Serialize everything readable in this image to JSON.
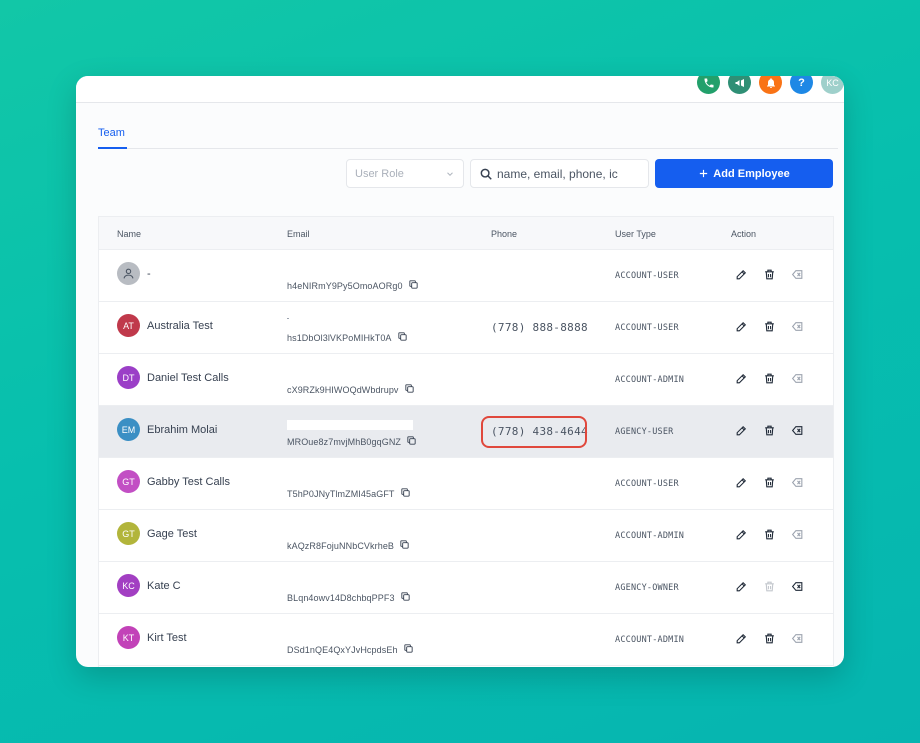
{
  "topbar": {
    "icons": [
      {
        "name": "phone-icon",
        "color": "#22a06b"
      },
      {
        "name": "megaphone-icon",
        "color": "#2f8f75"
      },
      {
        "name": "bell-icon",
        "color": "#f97316"
      },
      {
        "name": "help-icon",
        "color": "#1e88e5",
        "glyph": "?"
      }
    ],
    "user_initials": "KC"
  },
  "tabs": {
    "team": "Team"
  },
  "filters": {
    "role_placeholder": "User Role",
    "search_placeholder": "name, email, phone, ic",
    "add_button_label": "Add Employee",
    "add_button_color": "#155eef"
  },
  "table": {
    "headers": {
      "name": "Name",
      "email": "Email",
      "phone": "Phone",
      "user_type": "User Type",
      "action": "Action"
    },
    "rows": [
      {
        "initials": "",
        "avatar_color": "#b8bcc2",
        "name": "-",
        "email": "h4eNIRmY9Py5OmoAORg0",
        "phone": "",
        "user_type": "ACCOUNT-USER"
      },
      {
        "initials": "AT",
        "avatar_color": "#c0394b",
        "name": "Australia Test",
        "email": "hs1DbOl3lVKPoMIHkT0A",
        "phone": "(778) 888-8888",
        "user_type": "ACCOUNT-USER"
      },
      {
        "initials": "DT",
        "avatar_color": "#9b3fc7",
        "name": "Daniel Test Calls",
        "email": "cX9RZk9HIWOQdWbdrupv",
        "phone": "",
        "user_type": "ACCOUNT-ADMIN"
      },
      {
        "initials": "EM",
        "avatar_color": "#3b8fc4",
        "name": "Ebrahim Molai",
        "email": "MROue8z7mvjMhB0gqGNZ",
        "phone": "(778) 438-4644",
        "user_type": "AGENCY-USER"
      },
      {
        "initials": "GT",
        "avatar_color": "#c24fc4",
        "name": "Gabby Test Calls",
        "email": "T5hP0JNyTlmZMI45aGFT",
        "phone": "",
        "user_type": "ACCOUNT-USER"
      },
      {
        "initials": "GT",
        "avatar_color": "#b2b53b",
        "name": "Gage Test",
        "email": "kAQzR8FojuNNbCVkrheB",
        "phone": "",
        "user_type": "ACCOUNT-ADMIN"
      },
      {
        "initials": "KC",
        "avatar_color": "#a23fc2",
        "name": "Kate C",
        "email": "BLqn4owv14D8chbqPPF3",
        "phone": "",
        "user_type": "AGENCY-OWNER"
      },
      {
        "initials": "KT",
        "avatar_color": "#c242b8",
        "name": "Kirt Test",
        "email": "DSd1nQE4QxYJvHcpdsEh",
        "phone": "",
        "user_type": "ACCOUNT-ADMIN"
      }
    ]
  },
  "highlight": {
    "row_index": 3,
    "ring_color": "#e0483c"
  }
}
